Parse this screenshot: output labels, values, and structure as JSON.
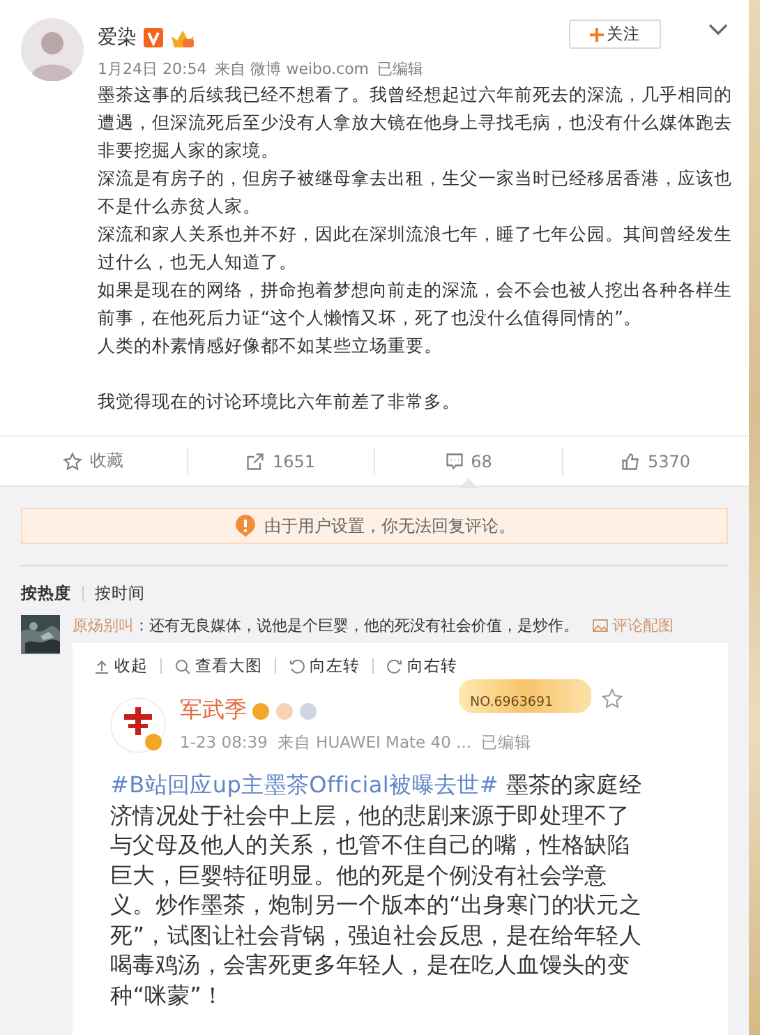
{
  "author": {
    "name": "爱染",
    "verified": true
  },
  "post_meta": {
    "time": "1月24日 20:54",
    "source": "来自 微博 weibo.com",
    "edited": "已编辑"
  },
  "follow_button": {
    "label": "关注"
  },
  "text_blocks": [
    [
      [
        "墨茶这事的后续我已经不想看了。我曾经想起过六年前死去的深流，几乎相同的",
        "遭遇，但深流死后至少没有人拿放大镜在他身上寻找毛病，也没有什么媒体跑去",
        "非要挖掘人家的家境。"
      ],
      [
        "深流是有房子的，但房子被继母拿去出租，生父一家当时已经移居香港，应该也",
        "不是什么赤贫人家。"
      ],
      [
        "深流和家人关系也并不好，因此在深圳流浪七年，睡了七年公园。其间曾经发生",
        "过什么，也无人知道了。"
      ],
      [
        "如果是现在的网络，拼命抱着梦想向前走的深流，会不会也被人挖出各种各样生",
        "前事，在他死后力证“这个人懒惰又坏，死了也没什么值得同情的”。"
      ],
      [
        "人类的朴素情感好像都不如某些立场重要。"
      ]
    ],
    [
      [
        "我觉得现在的讨论环境比六年前差了非常多。"
      ]
    ]
  ],
  "actions": [
    {
      "kind": "favorite",
      "label": "收藏",
      "selected": false
    },
    {
      "kind": "repost",
      "label": "1651",
      "selected": false
    },
    {
      "kind": "comment",
      "label": "68",
      "selected": true
    },
    {
      "kind": "like",
      "label": "5370",
      "selected": false
    }
  ],
  "notice": "由于用户设置，你无法回复评论。",
  "sort_tabs": [
    {
      "label": "按热度",
      "selected": true
    },
    {
      "label": "按时间",
      "selected": false
    }
  ],
  "comments": [
    {
      "user": "原炀别叫",
      "text": "：还有无良媒体，说他是个巨婴，他的死没有社会价值，是炒作。",
      "image_link": "评论配图",
      "image_toolbar": [
        {
          "kind": "collapse",
          "label": "收起"
        },
        {
          "kind": "zoom",
          "label": "查看大图"
        },
        {
          "kind": "rotate_left",
          "label": "向左转"
        },
        {
          "kind": "rotate_right",
          "label": "向右转"
        }
      ],
      "embedded_post": {
        "author": "军武季",
        "medal": "NO.6963691",
        "time": "1-23 08:39",
        "source": "来自 HUAWEI Mate 40 ...",
        "edited": "已编辑",
        "hashtag": "#B站回应up主墨茶Official被曝去世#",
        "lines": [
          " 墨茶的家庭经",
          "济情况处于社会中上层，他的悲剧来源于即处理不了",
          "与父母及他人的关系，也管不住自己的嘴，性格缺陷",
          "巨大，巨婴特征明显。他的死是个例没有社会学意",
          "义。炒作墨茶，炮制另一个版本的“出身寒门的状元之",
          "死”，试图让社会背锅，强迫社会反思，是在给年轻人",
          "喝毒鸡汤，会害死更多年轻人，是在吃人血馒头的变",
          "种“咪蒙”！"
        ]
      }
    }
  ]
}
